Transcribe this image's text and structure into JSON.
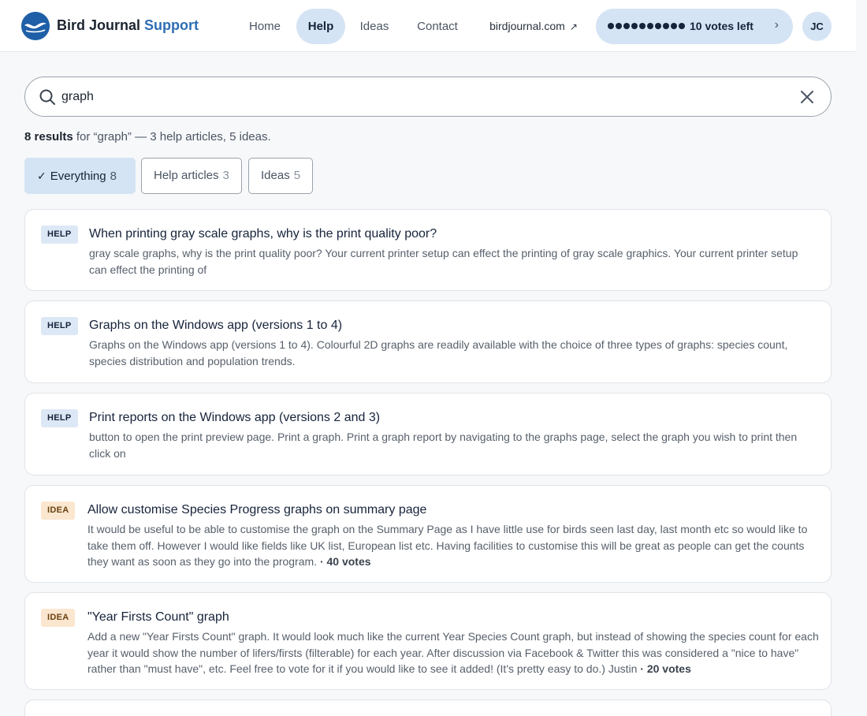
{
  "header": {
    "brand_main": "Bird Journal",
    "brand_accent": "Support",
    "nav": {
      "home": "Home",
      "help": "Help",
      "ideas": "Ideas",
      "contact": "Contact",
      "external": "birdjournal.com",
      "external_icon": "external-link-icon"
    },
    "votes": {
      "label": "10 votes left",
      "remaining": 10
    },
    "avatar_initials": "JC"
  },
  "search": {
    "value": "graph"
  },
  "summary": {
    "count_text": "8 results",
    "rest_text": "for “graph” — 3 help articles, 5 ideas."
  },
  "filters": {
    "everything": {
      "label": "Everything",
      "count": "8"
    },
    "help": {
      "label": "Help articles",
      "count": "3"
    },
    "ideas": {
      "label": "Ideas",
      "count": "5"
    }
  },
  "results": [
    {
      "badge": "HELP",
      "title": "When printing gray scale graphs, why is the print quality poor?",
      "body": "gray scale graphs, why is the print quality poor? Your current printer setup can effect the printing of gray scale graphics. Your current printer setup can effect the printing of"
    },
    {
      "badge": "HELP",
      "title": "Graphs on the Windows app (versions 1 to 4)",
      "body": "Graphs on the Windows app (versions 1 to 4). Colourful 2D graphs are readily available with the choice of three types of graphs: species count, species distribution and population trends."
    },
    {
      "badge": "HELP",
      "title": "Print reports on the Windows app (versions 2 and 3)",
      "body": "button to open the print preview page. Print a graph. Print a graph report by navigating to the graphs page, select the graph you wish to print then click on"
    },
    {
      "badge": "IDEA",
      "title": "Allow customise Species Progress graphs on summary page",
      "body": "It would be useful to be able to customise the graph on the Summary Page as I have little use for birds seen last day, last month etc so would like to take them off. However I would like fields like UK list, European list etc. Having facilities to customise this will be great as people can get the counts they want as soon as they go into the program.",
      "votes": "· 40 votes"
    },
    {
      "badge": "IDEA",
      "title": "\"Year Firsts Count\" graph",
      "body": "Add a new \"Year Firsts Count\" graph. It would look much like the current Year Species Count graph, but instead of showing the species count for each year it would show the number of lifers/firsts (filterable) for each year. After discussion via Facebook & Twitter this was considered a \"nice to have\" rather than \"must have\", etc. Feel free to vote for it if you would like to see it added! (It's pretty easy to do.) Justin",
      "votes": "· 20 votes"
    }
  ],
  "colors": {
    "accent": "#2e6db4",
    "pill_bg": "#d5e4f4",
    "help_badge": "#dce8f5",
    "idea_badge": "#fbe6cf"
  }
}
